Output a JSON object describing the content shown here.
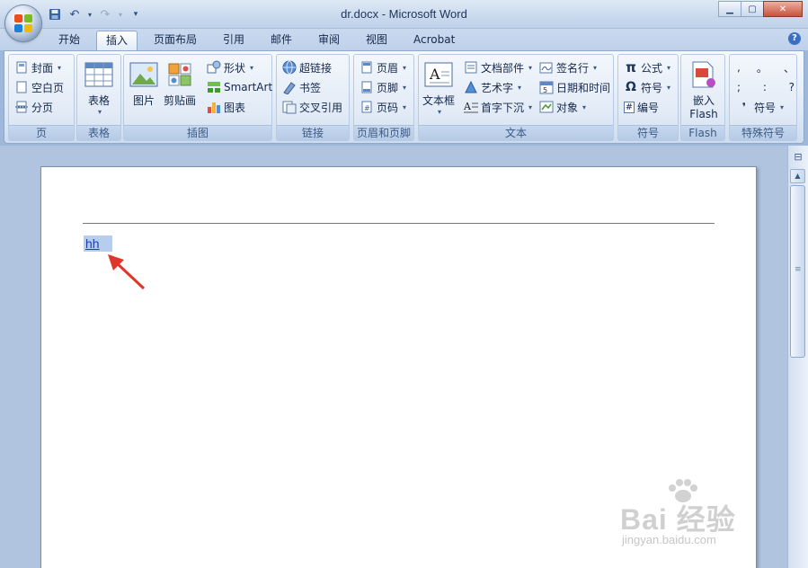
{
  "window": {
    "title": "dr.docx - Microsoft Word",
    "minimize": "▁",
    "maximize": "▢",
    "close": "✕"
  },
  "qat": {
    "save_icon": "💾",
    "undo_icon": "↶",
    "undo_dd": "▾",
    "redo_icon": "↷",
    "redo_dd": "▾",
    "customize": "▾"
  },
  "tabs": [
    "开始",
    "插入",
    "页面布局",
    "引用",
    "邮件",
    "审阅",
    "视图",
    "Acrobat"
  ],
  "active_tab": "插入",
  "help": "?",
  "ribbon": {
    "pages": {
      "label": "页",
      "cover": "封面",
      "blank": "空白页",
      "break": "分页"
    },
    "tables": {
      "label": "表格",
      "table": "表格"
    },
    "illustrations": {
      "label": "插图",
      "picture": "图片",
      "clipart": "剪贴画",
      "shapes": "形状",
      "smartart": "SmartArt",
      "chart": "图表"
    },
    "links": {
      "label": "链接",
      "hyperlink": "超链接",
      "bookmark": "书签",
      "crossref": "交叉引用"
    },
    "header_footer": {
      "label": "页眉和页脚",
      "header": "页眉",
      "footer": "页脚",
      "page_number": "页码"
    },
    "text": {
      "label": "文本",
      "textbox": "文本框",
      "quickparts": "文档部件",
      "wordart": "艺术字",
      "dropcap": "首字下沉",
      "signature": "签名行",
      "datetime": "日期和时间",
      "object": "对象"
    },
    "symbols": {
      "label": "符号",
      "equation": "公式",
      "symbol": "符号",
      "numbering": "编号",
      "pi": "π",
      "omega": "Ω",
      "hash": "#"
    },
    "flash": {
      "label": "Flash",
      "embed_line1": "嵌入",
      "embed_line2": "Flash"
    },
    "special": {
      "label": "特殊符号",
      "chars": [
        ",",
        "。",
        "、",
        ";",
        ":",
        "?"
      ],
      "symbol": "符号",
      "bullet": "❜"
    }
  },
  "document": {
    "text": "hh"
  },
  "scroll": {
    "up": "▲",
    "grip": "≡",
    "ruler": "⊟"
  },
  "watermark": {
    "main": "Bai 经验",
    "sub": "jingyan.baidu.com"
  },
  "colors": {
    "accent": "#3a6fc2",
    "arrow": "#e0352b",
    "selection": "#b6cdee",
    "link": "#1d3fae"
  }
}
